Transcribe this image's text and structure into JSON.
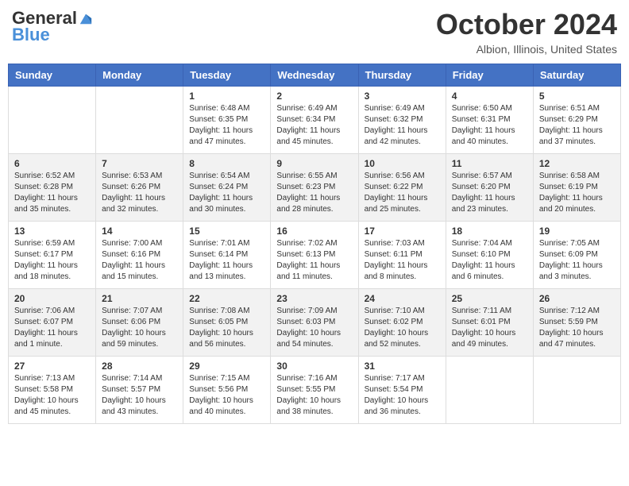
{
  "header": {
    "logo_general": "General",
    "logo_blue": "Blue",
    "month_title": "October 2024",
    "location": "Albion, Illinois, United States"
  },
  "days_of_week": [
    "Sunday",
    "Monday",
    "Tuesday",
    "Wednesday",
    "Thursday",
    "Friday",
    "Saturday"
  ],
  "weeks": [
    [
      {
        "day": "",
        "info": ""
      },
      {
        "day": "",
        "info": ""
      },
      {
        "day": "1",
        "info": "Sunrise: 6:48 AM\nSunset: 6:35 PM\nDaylight: 11 hours and 47 minutes."
      },
      {
        "day": "2",
        "info": "Sunrise: 6:49 AM\nSunset: 6:34 PM\nDaylight: 11 hours and 45 minutes."
      },
      {
        "day": "3",
        "info": "Sunrise: 6:49 AM\nSunset: 6:32 PM\nDaylight: 11 hours and 42 minutes."
      },
      {
        "day": "4",
        "info": "Sunrise: 6:50 AM\nSunset: 6:31 PM\nDaylight: 11 hours and 40 minutes."
      },
      {
        "day": "5",
        "info": "Sunrise: 6:51 AM\nSunset: 6:29 PM\nDaylight: 11 hours and 37 minutes."
      }
    ],
    [
      {
        "day": "6",
        "info": "Sunrise: 6:52 AM\nSunset: 6:28 PM\nDaylight: 11 hours and 35 minutes."
      },
      {
        "day": "7",
        "info": "Sunrise: 6:53 AM\nSunset: 6:26 PM\nDaylight: 11 hours and 32 minutes."
      },
      {
        "day": "8",
        "info": "Sunrise: 6:54 AM\nSunset: 6:24 PM\nDaylight: 11 hours and 30 minutes."
      },
      {
        "day": "9",
        "info": "Sunrise: 6:55 AM\nSunset: 6:23 PM\nDaylight: 11 hours and 28 minutes."
      },
      {
        "day": "10",
        "info": "Sunrise: 6:56 AM\nSunset: 6:22 PM\nDaylight: 11 hours and 25 minutes."
      },
      {
        "day": "11",
        "info": "Sunrise: 6:57 AM\nSunset: 6:20 PM\nDaylight: 11 hours and 23 minutes."
      },
      {
        "day": "12",
        "info": "Sunrise: 6:58 AM\nSunset: 6:19 PM\nDaylight: 11 hours and 20 minutes."
      }
    ],
    [
      {
        "day": "13",
        "info": "Sunrise: 6:59 AM\nSunset: 6:17 PM\nDaylight: 11 hours and 18 minutes."
      },
      {
        "day": "14",
        "info": "Sunrise: 7:00 AM\nSunset: 6:16 PM\nDaylight: 11 hours and 15 minutes."
      },
      {
        "day": "15",
        "info": "Sunrise: 7:01 AM\nSunset: 6:14 PM\nDaylight: 11 hours and 13 minutes."
      },
      {
        "day": "16",
        "info": "Sunrise: 7:02 AM\nSunset: 6:13 PM\nDaylight: 11 hours and 11 minutes."
      },
      {
        "day": "17",
        "info": "Sunrise: 7:03 AM\nSunset: 6:11 PM\nDaylight: 11 hours and 8 minutes."
      },
      {
        "day": "18",
        "info": "Sunrise: 7:04 AM\nSunset: 6:10 PM\nDaylight: 11 hours and 6 minutes."
      },
      {
        "day": "19",
        "info": "Sunrise: 7:05 AM\nSunset: 6:09 PM\nDaylight: 11 hours and 3 minutes."
      }
    ],
    [
      {
        "day": "20",
        "info": "Sunrise: 7:06 AM\nSunset: 6:07 PM\nDaylight: 11 hours and 1 minute."
      },
      {
        "day": "21",
        "info": "Sunrise: 7:07 AM\nSunset: 6:06 PM\nDaylight: 10 hours and 59 minutes."
      },
      {
        "day": "22",
        "info": "Sunrise: 7:08 AM\nSunset: 6:05 PM\nDaylight: 10 hours and 56 minutes."
      },
      {
        "day": "23",
        "info": "Sunrise: 7:09 AM\nSunset: 6:03 PM\nDaylight: 10 hours and 54 minutes."
      },
      {
        "day": "24",
        "info": "Sunrise: 7:10 AM\nSunset: 6:02 PM\nDaylight: 10 hours and 52 minutes."
      },
      {
        "day": "25",
        "info": "Sunrise: 7:11 AM\nSunset: 6:01 PM\nDaylight: 10 hours and 49 minutes."
      },
      {
        "day": "26",
        "info": "Sunrise: 7:12 AM\nSunset: 5:59 PM\nDaylight: 10 hours and 47 minutes."
      }
    ],
    [
      {
        "day": "27",
        "info": "Sunrise: 7:13 AM\nSunset: 5:58 PM\nDaylight: 10 hours and 45 minutes."
      },
      {
        "day": "28",
        "info": "Sunrise: 7:14 AM\nSunset: 5:57 PM\nDaylight: 10 hours and 43 minutes."
      },
      {
        "day": "29",
        "info": "Sunrise: 7:15 AM\nSunset: 5:56 PM\nDaylight: 10 hours and 40 minutes."
      },
      {
        "day": "30",
        "info": "Sunrise: 7:16 AM\nSunset: 5:55 PM\nDaylight: 10 hours and 38 minutes."
      },
      {
        "day": "31",
        "info": "Sunrise: 7:17 AM\nSunset: 5:54 PM\nDaylight: 10 hours and 36 minutes."
      },
      {
        "day": "",
        "info": ""
      },
      {
        "day": "",
        "info": ""
      }
    ]
  ]
}
